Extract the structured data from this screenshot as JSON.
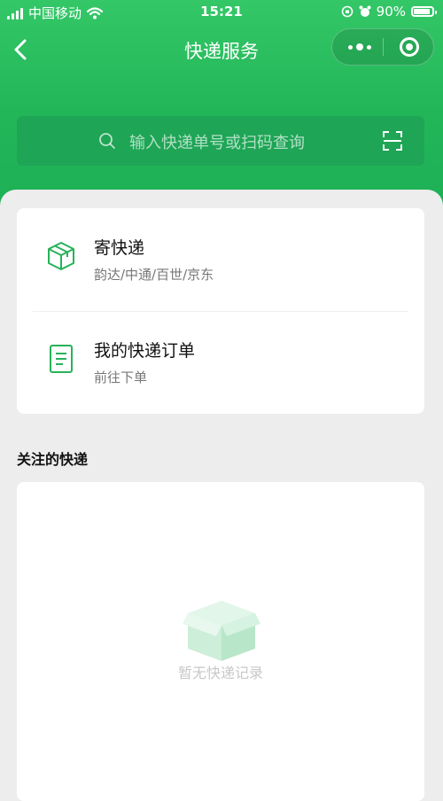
{
  "status_bar": {
    "carrier": "中国移动",
    "time": "15:21",
    "battery": "90%",
    "battery_level": 0.9
  },
  "nav": {
    "title": "快递服务",
    "back_icon": "chevron-left-icon",
    "more_icon": "more-dots-icon",
    "close_icon": "target-circle-icon"
  },
  "search": {
    "placeholder": "输入快递单号或扫码查询",
    "search_icon": "magnifier-icon",
    "scan_icon": "scan-icon"
  },
  "services": [
    {
      "title": "寄快递",
      "subtitle": "韵达/中通/百世/京东",
      "icon": "package-box-icon"
    },
    {
      "title": "我的快递订单",
      "subtitle": "前往下单",
      "icon": "document-list-icon"
    }
  ],
  "followed": {
    "section_title": "关注的快递",
    "empty_text": "暂无快递记录",
    "empty_icon": "empty-box-icon"
  },
  "colors": {
    "primary_green": "#22b659",
    "search_bg": "#1ea556",
    "icon_green": "#27b25a",
    "page_bg": "#ededed"
  }
}
